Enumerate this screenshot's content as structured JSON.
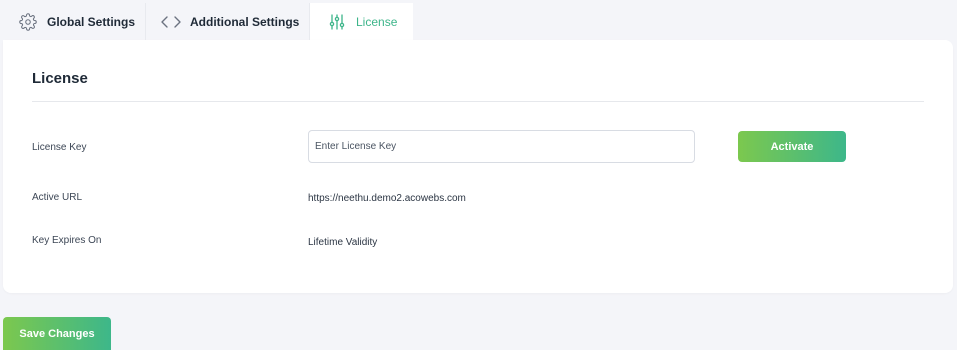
{
  "tabs": [
    {
      "label": "Global Settings",
      "icon": "gear-icon"
    },
    {
      "label": "Additional Settings",
      "icon": "code-brackets-icon"
    },
    {
      "label": "License",
      "icon": "sliders-icon",
      "active": true
    }
  ],
  "license": {
    "title": "License",
    "key_label": "License Key",
    "key_placeholder": "Enter License Key",
    "key_value": "",
    "activate_label": "Activate",
    "url_label": "Active URL",
    "url_value": "https://neethu.demo2.acowebs.com",
    "expires_label": "Key Expires On",
    "expires_value": "Lifetime Validity"
  },
  "footer": {
    "save_label": "Save Changes"
  },
  "colors": {
    "accent": "#3db58a",
    "gradient_start": "#7cc84e",
    "gradient_end": "#3db78a",
    "background": "#f4f5f9",
    "card": "#ffffff"
  }
}
